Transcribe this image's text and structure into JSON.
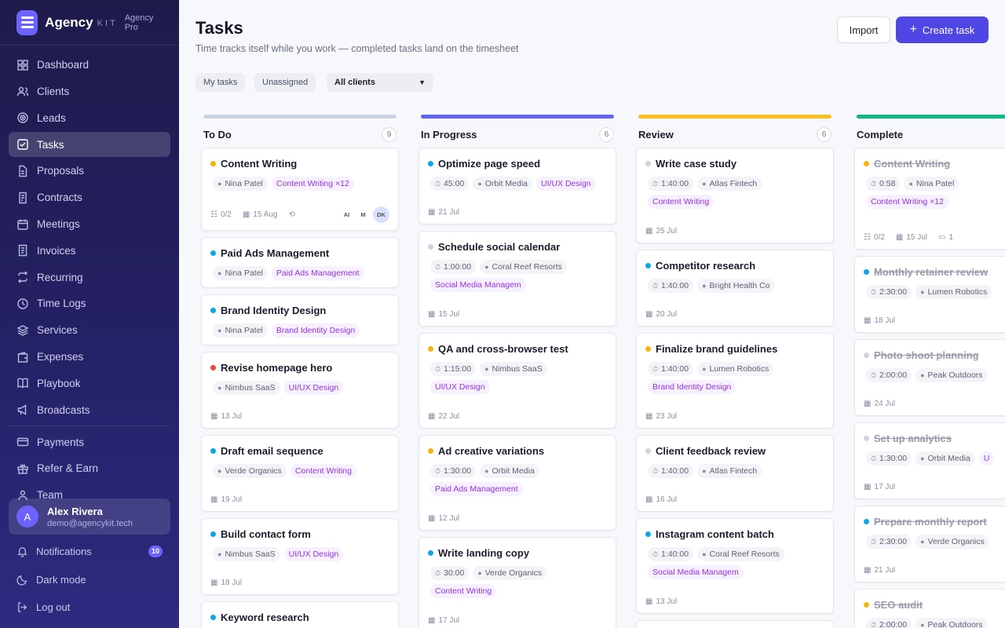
{
  "brand": {
    "name": "Agency",
    "kit": "KIT",
    "plan": "Agency Pro"
  },
  "nav": [
    {
      "label": "Dashboard",
      "icon": "dashboard-icon"
    },
    {
      "label": "Clients",
      "icon": "users-icon"
    },
    {
      "label": "Leads",
      "icon": "target-icon"
    },
    {
      "label": "Tasks",
      "icon": "checkbox-icon",
      "active": true
    },
    {
      "label": "Proposals",
      "icon": "document-icon"
    },
    {
      "label": "Contracts",
      "icon": "contract-icon"
    },
    {
      "label": "Meetings",
      "icon": "calendar-icon"
    },
    {
      "label": "Invoices",
      "icon": "invoice-icon"
    },
    {
      "label": "Recurring",
      "icon": "repeat-icon"
    },
    {
      "label": "Time Logs",
      "icon": "clock-icon"
    },
    {
      "label": "Services",
      "icon": "layers-icon"
    },
    {
      "label": "Expenses",
      "icon": "wallet-icon"
    },
    {
      "label": "Playbook",
      "icon": "book-icon"
    },
    {
      "label": "Broadcasts",
      "icon": "megaphone-icon"
    },
    {
      "label": "Payments",
      "icon": "credit-card-icon"
    },
    {
      "label": "Refer & Earn",
      "icon": "gift-icon"
    },
    {
      "label": "Team",
      "icon": "team-icon"
    }
  ],
  "user": {
    "initial": "A",
    "name": "Alex Rivera",
    "email": "demo@agencykit.tech"
  },
  "footer": {
    "notifications": "Notifications",
    "notifications_count": "10",
    "dark_mode": "Dark mode",
    "logout": "Log out"
  },
  "header": {
    "title": "Tasks",
    "subtitle": "Time tracks itself while you work — completed tasks land on the timesheet",
    "import": "Import",
    "create": "Create task"
  },
  "filters": {
    "my_tasks": "My tasks",
    "unassigned": "Unassigned",
    "clients": "All clients"
  },
  "colors": {
    "accent": "#4f46e5",
    "todo": "#cbd5e1",
    "progress": "#6366f1",
    "review": "#fbbf24",
    "complete": "#10b981"
  },
  "columns": [
    {
      "title": "To Do",
      "count": "9",
      "color": "#cbd5e1",
      "cards": [
        {
          "title": "Content Writing",
          "dot": "#f5b40b",
          "client": "Nina Patel",
          "service": "Content Writing ×12",
          "progress": "0/2",
          "date": "15 Aug",
          "repeat": true,
          "assignees": [
            "AI",
            "M",
            "DK"
          ],
          "h": 106
        },
        {
          "title": "Paid Ads Management",
          "dot": "#0ea5e9",
          "client": "Nina Patel",
          "service": "Paid Ads Management",
          "h": 65
        },
        {
          "title": "Brand Identity Design",
          "dot": "#0ea5e9",
          "client": "Nina Patel",
          "service": "Brand Identity Design",
          "h": 65
        },
        {
          "title": "Revise homepage hero",
          "dot": "#ef4444",
          "client": "Nimbus SaaS",
          "service": "UI/UX Design",
          "date": "13 Jul",
          "h": 98
        },
        {
          "title": "Draft email sequence",
          "dot": "#0ea5e9",
          "client": "Verde Organics",
          "service": "Content Writing",
          "date": "19 Jul",
          "h": 98
        },
        {
          "title": "Build contact form",
          "dot": "#0ea5e9",
          "client": "Nimbus SaaS",
          "service": "UI/UX Design",
          "date": "18 Jul",
          "h": 98
        },
        {
          "title": "Keyword research",
          "dot": "#0ea5e9",
          "h": 60
        }
      ]
    },
    {
      "title": "In Progress",
      "count": "6",
      "color": "#6366f1",
      "cards": [
        {
          "title": "Optimize page speed",
          "dot": "#0ea5e9",
          "time": "45:00",
          "client": "Orbit Media",
          "service": "UI/UX Design",
          "date": "21 Jul",
          "h": 98
        },
        {
          "title": "Schedule social calendar",
          "dot": "#cbd5e1",
          "time": "1:00:00",
          "client": "Coral Reef Resorts",
          "service": "Social Media Managem",
          "date": "15 Jul",
          "h": 122
        },
        {
          "title": "QA and cross-browser test",
          "dot": "#f5b40b",
          "time": "1:15:00",
          "client": "Nimbus SaaS",
          "service": "UI/UX Design",
          "date": "22 Jul",
          "h": 122
        },
        {
          "title": "Ad creative variations",
          "dot": "#f5b40b",
          "time": "1:30:00",
          "client": "Orbit Media",
          "service": "Paid Ads Management",
          "date": "12 Jul",
          "h": 122
        },
        {
          "title": "Write landing copy",
          "dot": "#0ea5e9",
          "time": "30:00",
          "client": "Verde Organics",
          "service": "Content Writing",
          "date": "17 Jul",
          "h": 122
        }
      ]
    },
    {
      "title": "Review",
      "count": "6",
      "color": "#fbbf24",
      "cards": [
        {
          "title": "Write case study",
          "dot": "#cbd5e1",
          "time": "1:40:00",
          "client": "Atlas Fintech",
          "service": "Content Writing",
          "date": "25 Jul",
          "h": 122
        },
        {
          "title": "Competitor research",
          "dot": "#0ea5e9",
          "time": "1:40:00",
          "client": "Bright Health Co",
          "date": "20 Jul",
          "h": 98
        },
        {
          "title": "Finalize brand guidelines",
          "dot": "#f5b40b",
          "time": "1:40:00",
          "client": "Lumen Robotics",
          "service": "Brand Identity Design",
          "date": "23 Jul",
          "h": 122
        },
        {
          "title": "Client feedback review",
          "dot": "#cbd5e1",
          "time": "1:40:00",
          "client": "Atlas Fintech",
          "date": "16 Jul",
          "h": 98
        },
        {
          "title": "Instagram content batch",
          "dot": "#0ea5e9",
          "time": "1:40:00",
          "client": "Coral Reef Resorts",
          "service": "Social Media Managem",
          "date": "13 Jul",
          "h": 122
        },
        {
          "title": "",
          "dot": "#cbd5e1",
          "h": 40
        }
      ]
    },
    {
      "title": "Complete",
      "count": "",
      "color": "#10b981",
      "cards": [
        {
          "title": "Content Writing",
          "dot": "#f5b40b",
          "done": true,
          "time": "0:58",
          "client": "Nina Patel",
          "service": "Content Writing ×12",
          "progress": "0/2",
          "date": "15 Jul",
          "comments": "1",
          "h": 130
        },
        {
          "title": "Monthly retainer review",
          "dot": "#0ea5e9",
          "done": true,
          "time": "2:30:00",
          "client": "Lumen Robotics",
          "date": "18 Jul",
          "h": 98
        },
        {
          "title": "Photo shoot planning",
          "dot": "#cbd5e1",
          "done": true,
          "time": "2:00:00",
          "client": "Peak Outdoors",
          "date": "24 Jul",
          "h": 98
        },
        {
          "title": "Set up analytics",
          "dot": "#cbd5e1",
          "done": true,
          "time": "1:30:00",
          "client": "Orbit Media",
          "service": "U",
          "date": "17 Jul",
          "h": 98
        },
        {
          "title": "Prepare monthly report",
          "dot": "#0ea5e9",
          "done": true,
          "time": "2:30:00",
          "client": "Verde Organics",
          "date": "21 Jul",
          "h": 98
        },
        {
          "title": "SEO audit",
          "dot": "#f5b40b",
          "done": true,
          "time": "2:00:00",
          "client": "Peak Outdoors",
          "h": 60
        }
      ]
    }
  ]
}
